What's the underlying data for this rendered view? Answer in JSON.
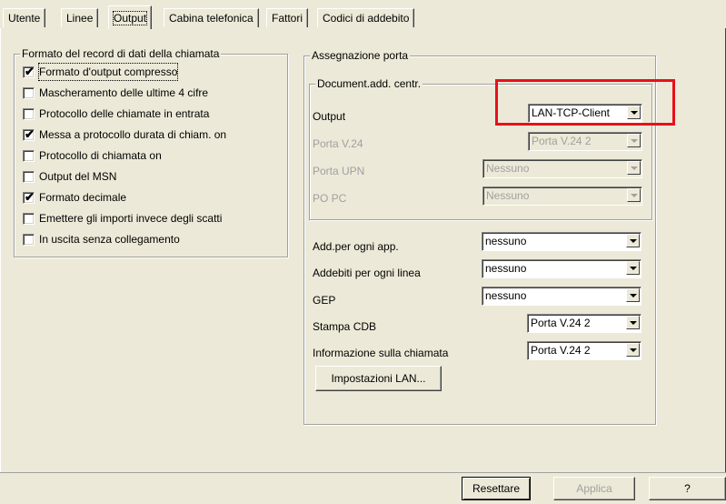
{
  "tabs": [
    {
      "label": "Utente"
    },
    {
      "label": "Linee"
    },
    {
      "label": "Output"
    },
    {
      "label": "Cabina telefonica"
    },
    {
      "label": "Fattori"
    },
    {
      "label": "Codici di addebito"
    }
  ],
  "record_group": {
    "title": "Formato del record di dati della chiamata",
    "items": [
      {
        "label": "Formato d'output compresso",
        "checked": true
      },
      {
        "label": "Mascheramento delle ultime 4 cifre",
        "checked": false
      },
      {
        "label": "Protocollo delle chiamate in entrata",
        "checked": false
      },
      {
        "label": "Messa a protocollo durata di chiam. on",
        "checked": true
      },
      {
        "label": "Protocollo di chiamata on",
        "checked": false
      },
      {
        "label": "Output del MSN",
        "checked": false
      },
      {
        "label": "Formato decimale",
        "checked": true
      },
      {
        "label": "Emettere gli importi invece degli scatti",
        "checked": false
      },
      {
        "label": "In uscita senza collegamento",
        "checked": false
      }
    ]
  },
  "port_group": {
    "title": "Assegnazione porta",
    "doc_group": {
      "title": "Document.add. centr.",
      "rows": [
        {
          "label": "Output",
          "value": "LAN-TCP-Client",
          "enabled": true
        },
        {
          "label": "Porta V.24",
          "value": "Porta V.24 2",
          "enabled": false
        },
        {
          "label": "Porta UPN",
          "value": "Nessuno",
          "enabled": false
        },
        {
          "label": "PO PC",
          "value": "Nessuno",
          "enabled": false
        }
      ]
    },
    "rows": [
      {
        "label": "Add.per ogni app.",
        "value": "nessuno"
      },
      {
        "label": "Addebiti per ogni linea",
        "value": "nessuno"
      },
      {
        "label": "GEP",
        "value": "nessuno"
      },
      {
        "label": "Stampa CDB",
        "value": "Porta V.24 2"
      },
      {
        "label": "Informazione sulla chiamata",
        "value": "Porta V.24 2"
      }
    ],
    "lan_button": "Impostazioni LAN..."
  },
  "footer": {
    "reset": "Resettare",
    "apply": "Applica",
    "help": "?"
  },
  "colors": {
    "face": "#ece9d8",
    "highlight": "#e8101a",
    "disabled_text": "#a0a0a0"
  }
}
